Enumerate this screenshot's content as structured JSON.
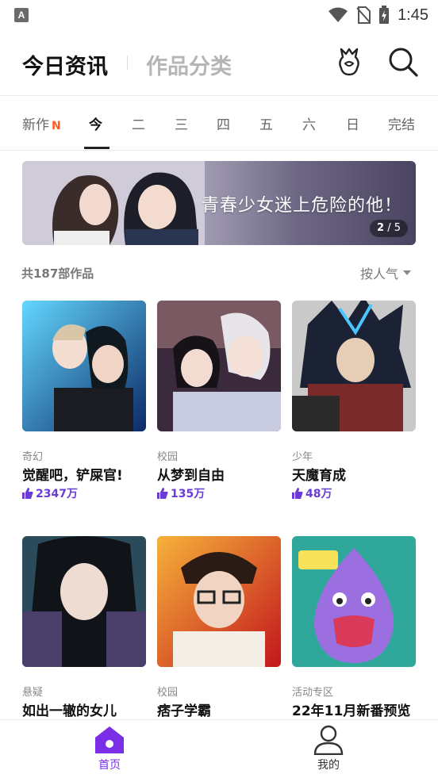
{
  "status_bar": {
    "app_icon_letter": "A",
    "time": "1:45"
  },
  "header": {
    "tab_active": "今日资讯",
    "tab_inactive": "作品分类"
  },
  "weekdays": [
    {
      "label": "新作",
      "badge": "N"
    },
    {
      "label": "今"
    },
    {
      "label": "二"
    },
    {
      "label": "三"
    },
    {
      "label": "四"
    },
    {
      "label": "五"
    },
    {
      "label": "六"
    },
    {
      "label": "日"
    },
    {
      "label": "完结"
    }
  ],
  "banner": {
    "text": "青春少女迷上危险的他！",
    "page_current": "2",
    "page_sep": "/",
    "page_total": "5"
  },
  "list": {
    "count_text": "共187部作品",
    "sort_label": "按人气"
  },
  "cards": [
    {
      "genre": "奇幻",
      "title": "觉醒吧，铲屎官!",
      "likes": "2347万"
    },
    {
      "genre": "校园",
      "title": "从梦到自由",
      "likes": "135万"
    },
    {
      "genre": "少年",
      "title": "天魔育成",
      "likes": "48万"
    },
    {
      "genre": "悬疑",
      "title": "如出一辙的女儿",
      "likes": ""
    },
    {
      "genre": "校园",
      "title": "痞子学霸",
      "likes": ""
    },
    {
      "genre": "活动专区",
      "title": "22年11月新番预览",
      "likes": ""
    }
  ],
  "bottom_nav": {
    "home_label": "首页",
    "mine_label": "我的"
  },
  "colors": {
    "accent": "#7a2ee6",
    "new_badge": "#ff5a1f",
    "likes": "#6a3bd6"
  }
}
